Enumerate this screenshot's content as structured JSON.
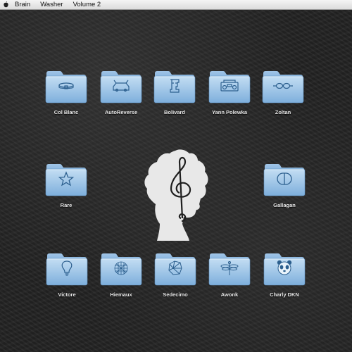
{
  "menubar": {
    "items": [
      "Brain",
      "Washer",
      "Volume 2"
    ]
  },
  "colors": {
    "folder_top": "#bcd9f1",
    "folder_bottom": "#7fb0dd",
    "folder_tab": "#a9cbea",
    "emblem": "#2c5f8e",
    "label": "#eaeaea",
    "logo": "#e8e8e8"
  },
  "folders": [
    {
      "label": "Col Blanc",
      "icon": "collar-icon"
    },
    {
      "label": "AutoReverse",
      "icon": "car-icon"
    },
    {
      "label": "Bolivard",
      "icon": "moai-icon"
    },
    {
      "label": "Yann Polewka",
      "icon": "boombox-icon"
    },
    {
      "label": "Zoltan",
      "icon": "goggles-icon"
    },
    {
      "label": "Rare",
      "icon": "star-icon"
    },
    {
      "label": "Gallagan",
      "icon": "pill-icon"
    },
    {
      "label": "Victore",
      "icon": "lightbulb-icon"
    },
    {
      "label": "Hiemaux",
      "icon": "globe-grid-icon"
    },
    {
      "label": "Sedecimo",
      "icon": "crumpled-paper-icon"
    },
    {
      "label": "Awonk",
      "icon": "dragonfly-icon"
    },
    {
      "label": "Charly DKN",
      "icon": "panda-icon"
    }
  ],
  "center_logo": "treble-clef-afro-profile-logo"
}
